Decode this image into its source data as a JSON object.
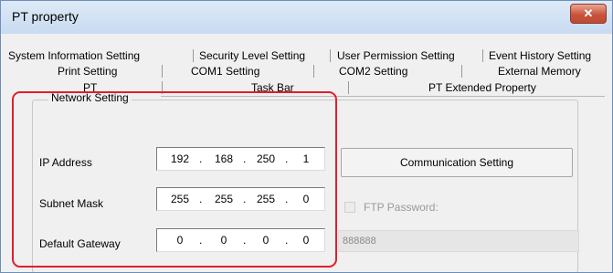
{
  "window": {
    "title": "PT property",
    "close_symbol": "✕"
  },
  "tabs": {
    "row1": [
      "System Information Setting",
      "Security Level Setting",
      "User Permission Setting",
      "Event History Setting"
    ],
    "row2": [
      "Print Setting",
      "COM1 Setting",
      "COM2 Setting",
      "External Memory"
    ],
    "row3": [
      "PT",
      "Task Bar",
      "PT Extended Property"
    ],
    "active": "PT"
  },
  "network": {
    "group_label": "Network Setting",
    "ip_label": "IP Address",
    "ip_value": [
      "192",
      "168",
      "250",
      "1"
    ],
    "subnet_label": "Subnet Mask",
    "subnet_value": [
      "255",
      "255",
      "255",
      "0"
    ],
    "gateway_label": "Default Gateway",
    "gateway_value": [
      "0",
      "0",
      "0",
      "0"
    ]
  },
  "communication_button": "Communication Setting",
  "ftp": {
    "label": "FTP Password:",
    "checked": false,
    "enabled": false,
    "password": "888888"
  },
  "colors": {
    "highlight": "#e21d2c",
    "close_button": "#c9543c",
    "titlebar": "#c9dbf1"
  }
}
